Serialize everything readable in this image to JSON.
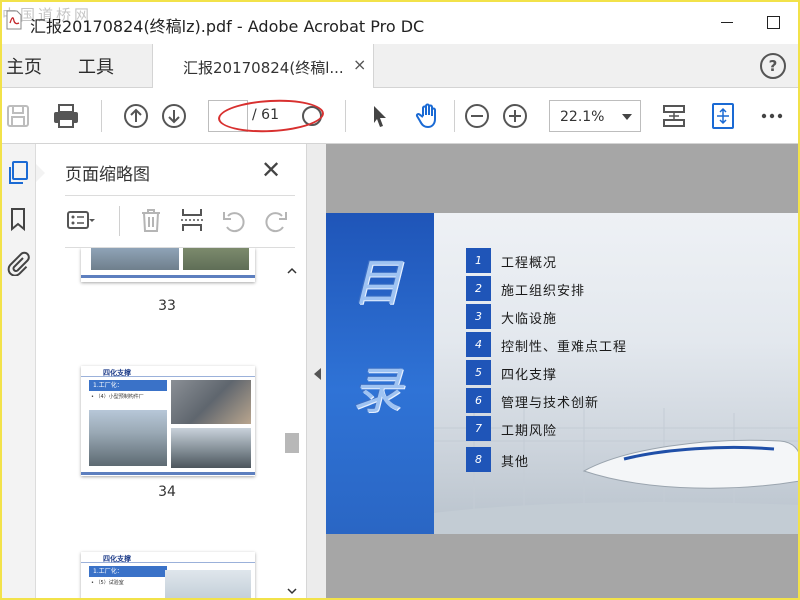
{
  "window": {
    "title": "汇报20170824(终稿lz).pdf - Adobe Acrobat Pro DC",
    "watermark": "中国道桥网"
  },
  "nav": {
    "home": "主页",
    "tools": "工具",
    "doc_tab": "汇报20170824(终稿l...",
    "doc_tab_close": "×",
    "help": "?"
  },
  "toolbar": {
    "page_current": "",
    "page_total": "/ 61",
    "zoom": "22.1%"
  },
  "thumbnails_panel": {
    "title": "页面缩略图",
    "close": "✕",
    "pages": [
      {
        "label": "33"
      },
      {
        "label": "34",
        "header": "四化支撑",
        "heading": "1.工厂化：",
        "bullet": "• （4）小型预制构件厂"
      },
      {
        "header": "四化支撑",
        "heading": "1.工厂化：",
        "bullet": "• （5）试验室"
      }
    ]
  },
  "slide": {
    "title_chars": [
      "目",
      "录"
    ],
    "items": [
      {
        "num": "1",
        "text": "工程概况"
      },
      {
        "num": "2",
        "text": "施工组织安排"
      },
      {
        "num": "3",
        "text": "大临设施"
      },
      {
        "num": "4",
        "text": "控制性、重难点工程"
      },
      {
        "num": "5",
        "text": "四化支撑"
      },
      {
        "num": "6",
        "text": "管理与技术创新"
      },
      {
        "num": "7",
        "text": "工期风险"
      },
      {
        "num": "8",
        "text": "其他"
      }
    ]
  },
  "colors": {
    "accent_blue": "#1f55b8",
    "highlight_red": "#d8302f",
    "frame_yellow": "#f2e24a"
  },
  "icons": [
    "pdf-app-icon",
    "minimize-icon",
    "maximize-icon",
    "help-icon",
    "save-icon",
    "print-icon",
    "page-up-icon",
    "page-down-icon",
    "select-arrow-icon",
    "hand-tool-icon",
    "zoom-out-icon",
    "zoom-in-icon",
    "fit-page-icon",
    "scroll-mode-icon",
    "more-icon",
    "page-thumbnails-icon",
    "bookmark-icon",
    "attachment-icon",
    "options-menu-icon",
    "delete-icon",
    "insert-page-icon",
    "rotate-left-icon",
    "rotate-right-icon"
  ]
}
